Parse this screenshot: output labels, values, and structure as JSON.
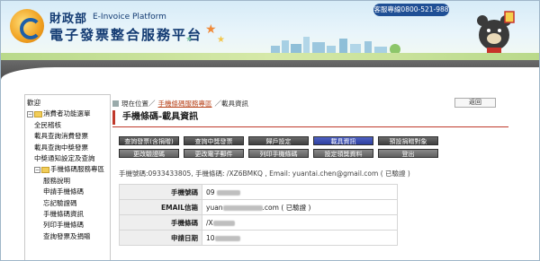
{
  "header": {
    "agency": "財政部",
    "agency_en": "E-Invoice Platform",
    "platform": "電子發票整合服務平台",
    "hotline": "客服專線0800-521-988"
  },
  "sidebar": {
    "items": [
      {
        "label": "歡迎",
        "level": 0
      },
      {
        "label": "消費者功能選單",
        "level": 1
      },
      {
        "label": "全民稽核",
        "level": 2
      },
      {
        "label": "載具查詢消費發票",
        "level": 2
      },
      {
        "label": "載具查詢中獎發票",
        "level": 2
      },
      {
        "label": "中獎通知設定及查詢",
        "level": 2
      },
      {
        "label": "手機條碼服務專區",
        "level": 1
      },
      {
        "label": "服務說明",
        "level": 3
      },
      {
        "label": "申請手機條碼",
        "level": 3
      },
      {
        "label": "忘記驗證碼",
        "level": 3
      },
      {
        "label": "手機條碼資訊",
        "level": 3
      },
      {
        "label": "列印手機條碼",
        "level": 3
      },
      {
        "label": "查詢發票及捐贈",
        "level": 3
      }
    ]
  },
  "breadcrumb": {
    "prefix": "現在位置／",
    "link": "手機條碼服務專區",
    "suffix": "／載具資訊"
  },
  "back_label": "返回",
  "page_title": "手機條碼-載具資訊",
  "buttons": [
    {
      "label": "查詢發票(含捐贈)"
    },
    {
      "label": "查詢中獎發票"
    },
    {
      "label": "歸戶設定"
    },
    {
      "label": "載具資訊",
      "active": true
    },
    {
      "label": "預設捐贈對象"
    },
    {
      "label": "更改驗證碼"
    },
    {
      "label": "更改電子郵件"
    },
    {
      "label": "列印手機條碼"
    },
    {
      "label": "設定領獎資料"
    },
    {
      "label": "登出"
    }
  ],
  "summary": "手機號碼:0933433805, 手機條碼: /XZ6BMKQ , Email: yuantai.chen@gmail.com ( 已驗證 )",
  "info": [
    {
      "label": "手機號碼",
      "value": "09"
    },
    {
      "label": "EMAIL信箱",
      "value_start": "yuan",
      "value_end": ".com ( 已驗證 )"
    },
    {
      "label": "手機條碼",
      "value": "/X"
    },
    {
      "label": "申請日期",
      "value": "10"
    }
  ],
  "colors": {
    "accent": "#c0392b",
    "active_button": "#3b4fb0",
    "link": "#b8431b"
  }
}
